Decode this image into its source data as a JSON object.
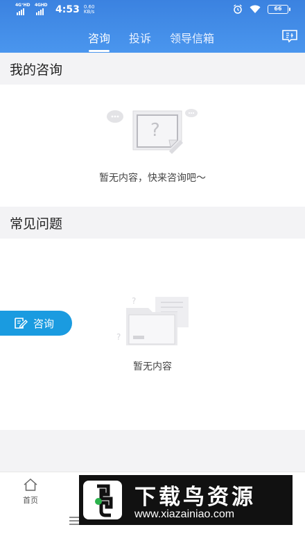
{
  "status_bar": {
    "signal_1_label": "4G⁺HD",
    "signal_2_label": "4GHD",
    "time": "4:53",
    "speed_value": "0.60",
    "speed_unit": "KB/s",
    "battery": "66"
  },
  "tabs": [
    {
      "label": "咨询",
      "active": true
    },
    {
      "label": "投诉",
      "active": false
    },
    {
      "label": "领导信箱",
      "active": false
    }
  ],
  "header_right_icon": "message-form-icon",
  "my_consultation": {
    "title": "我的咨询",
    "empty_text": "暂无内容，快来咨询吧～"
  },
  "faq": {
    "title": "常见问题",
    "empty_text": "暂无内容"
  },
  "float_button": {
    "label": "咨询",
    "icon": "edit-form-icon"
  },
  "bottom_nav": {
    "home_label": "首页"
  },
  "watermark": {
    "title": "下载鸟资源",
    "url": "www.xiazainiao.com"
  },
  "colors": {
    "header": "#3b82e0",
    "accent": "#1a9be0",
    "background": "#f3f3f5"
  }
}
